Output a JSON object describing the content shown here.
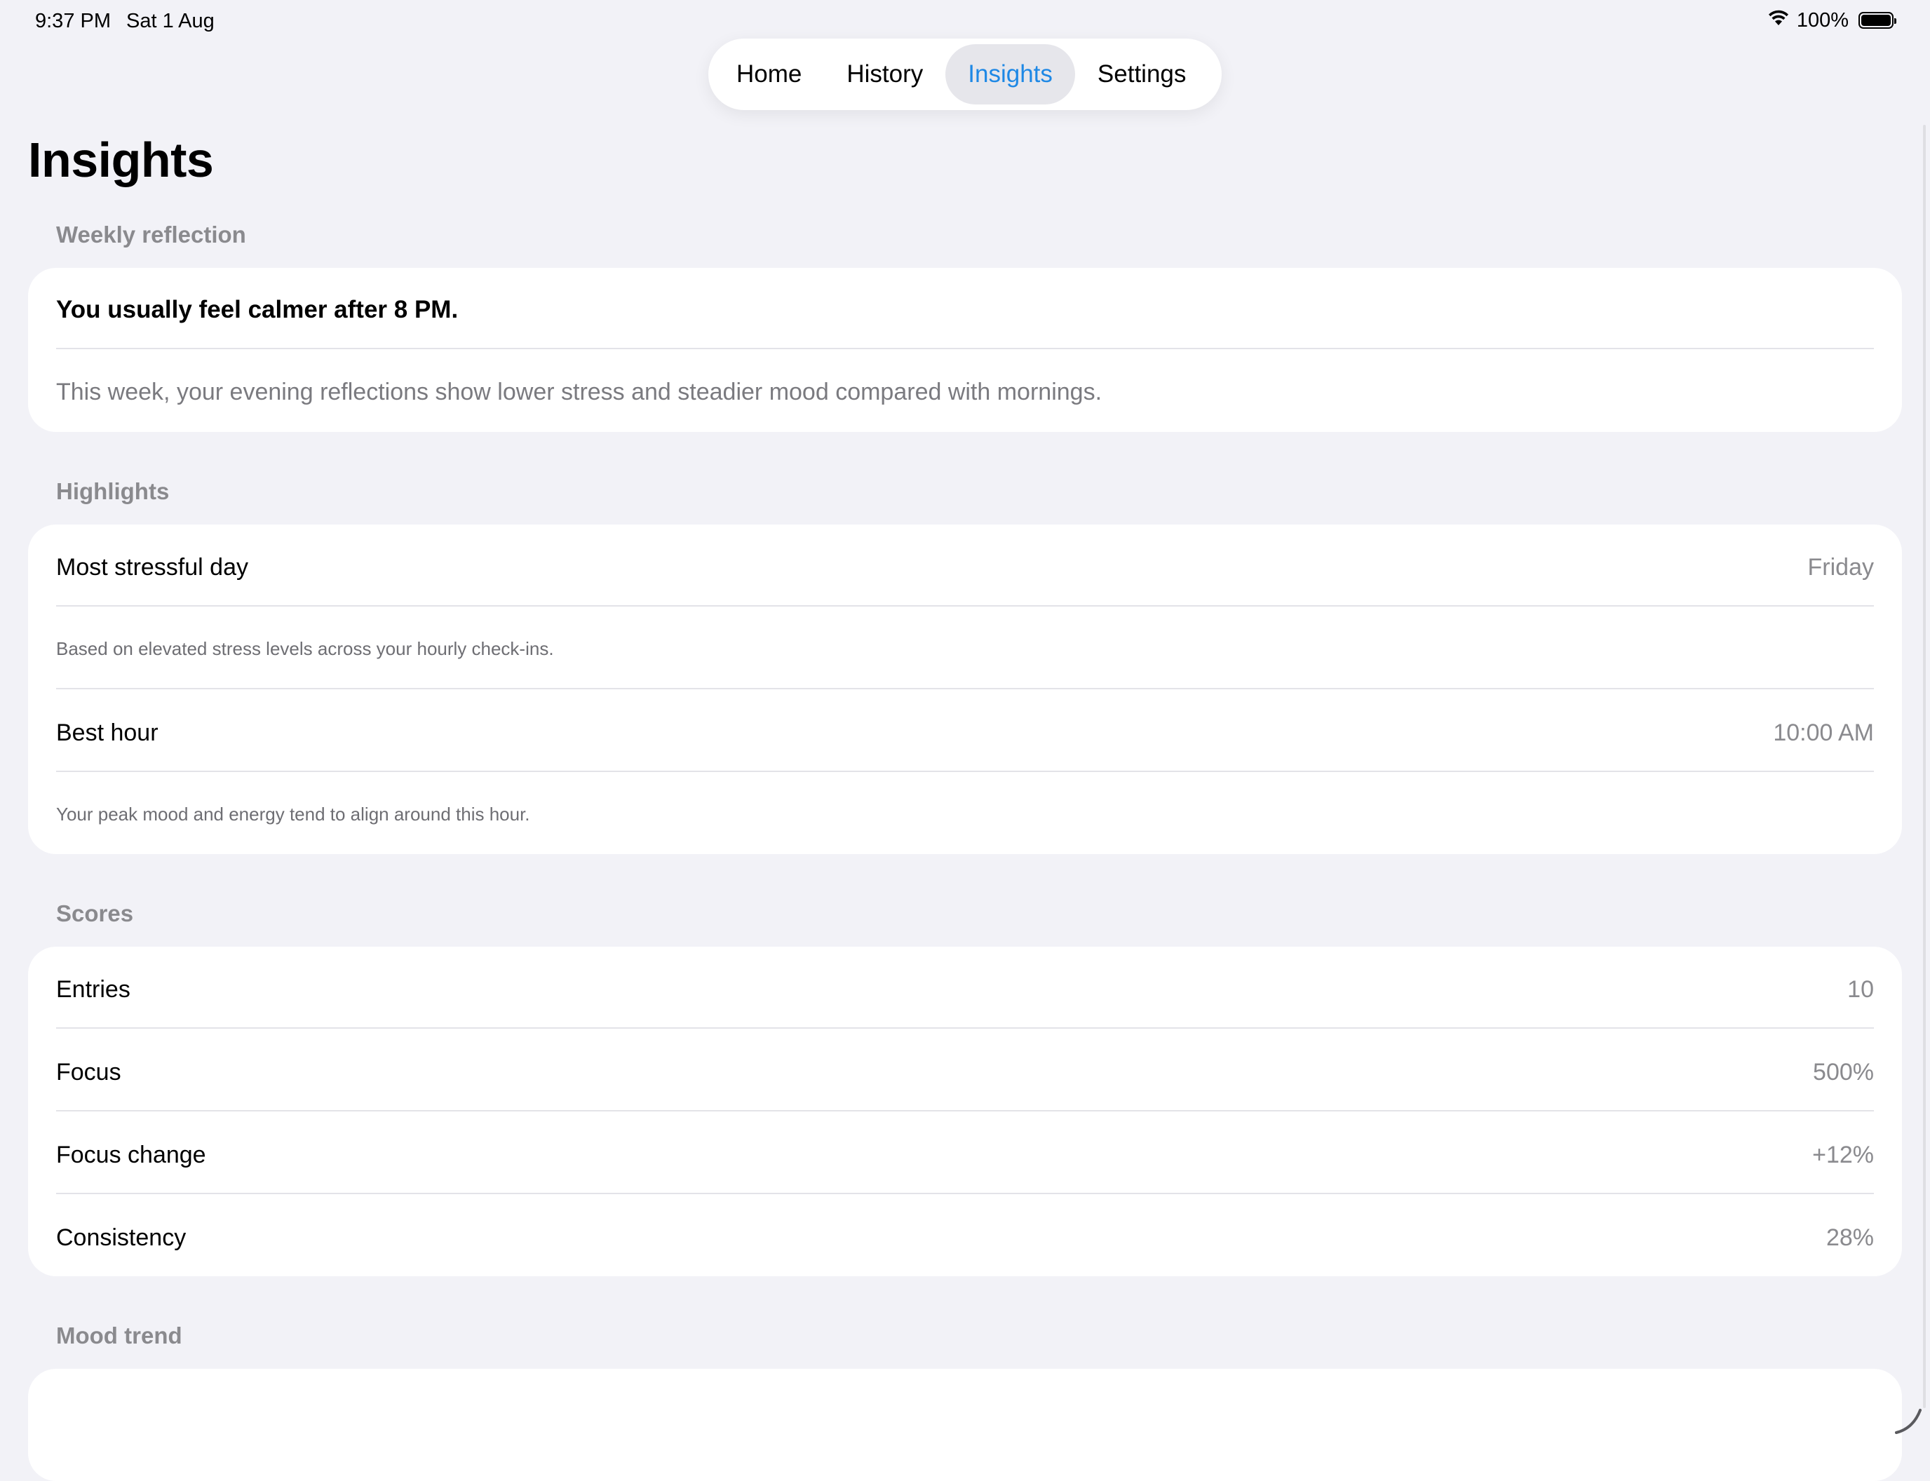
{
  "status_bar": {
    "time": "9:37 PM",
    "date": "Sat 1 Aug",
    "battery": "100%",
    "wifi_icon": "wifi-icon",
    "battery_icon": "battery-icon"
  },
  "tabs": [
    {
      "label": "Home",
      "active": false
    },
    {
      "label": "History",
      "active": false
    },
    {
      "label": "Insights",
      "active": true
    },
    {
      "label": "Settings",
      "active": false
    }
  ],
  "page": {
    "title": "Insights"
  },
  "weekly_reflection": {
    "header": "Weekly reflection",
    "title": "You usually feel calmer after 8 PM.",
    "body": "This week, your evening reflections show lower stress and steadier mood compared with mornings."
  },
  "highlights": {
    "header": "Highlights",
    "items": [
      {
        "label": "Most stressful day",
        "value": "Friday",
        "note": "Based on elevated stress levels across your hourly check-ins."
      },
      {
        "label": "Best hour",
        "value": "10:00 AM",
        "note": "Your peak mood and energy tend to align around this hour."
      }
    ]
  },
  "scores": {
    "header": "Scores",
    "items": [
      {
        "label": "Entries",
        "value": "10"
      },
      {
        "label": "Focus",
        "value": "500%"
      },
      {
        "label": "Focus change",
        "value": "+12%"
      },
      {
        "label": "Consistency",
        "value": "28%"
      }
    ]
  },
  "mood_trend": {
    "header": "Mood trend"
  },
  "colors": {
    "accent": "#1e88e5",
    "background": "#f2f2f7",
    "card": "#ffffff",
    "secondary_text": "#8a8a8e"
  }
}
